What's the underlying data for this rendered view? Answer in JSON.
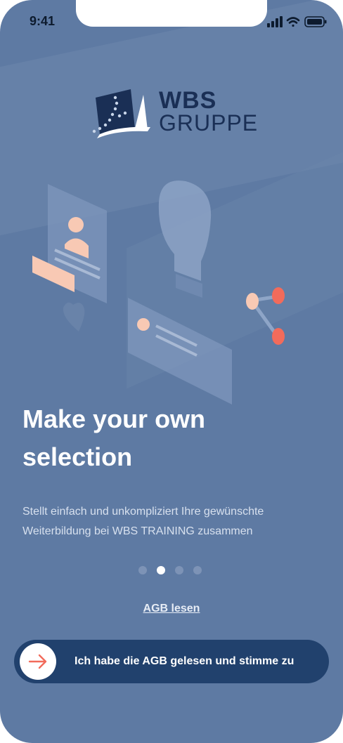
{
  "status_bar": {
    "time": "9:41",
    "signal_icon": "signal-icon",
    "wifi_icon": "wifi-icon",
    "battery_icon": "battery-icon"
  },
  "logo": {
    "line1": "WBS",
    "line2": "GRUPPE"
  },
  "onboarding": {
    "headline_line1": "Make your own",
    "headline_line2": "selection",
    "body_line1": "Stellt einfach und unkompliziert Ihre gewünschte",
    "body_line2": "Weiterbildung bei WBS TRAINING zusammen",
    "pages_total": 4,
    "page_active": 2
  },
  "agb_link": "AGB lesen",
  "cta": {
    "label": "Ich habe die AGB gelesen und stimme zu",
    "icon": "arrow-right-icon"
  },
  "colors": {
    "background": "#5e7aa3",
    "button": "#21416d",
    "accent": "#f26b5b",
    "peach": "#f8c9b4",
    "logo": "#1a2f55"
  }
}
